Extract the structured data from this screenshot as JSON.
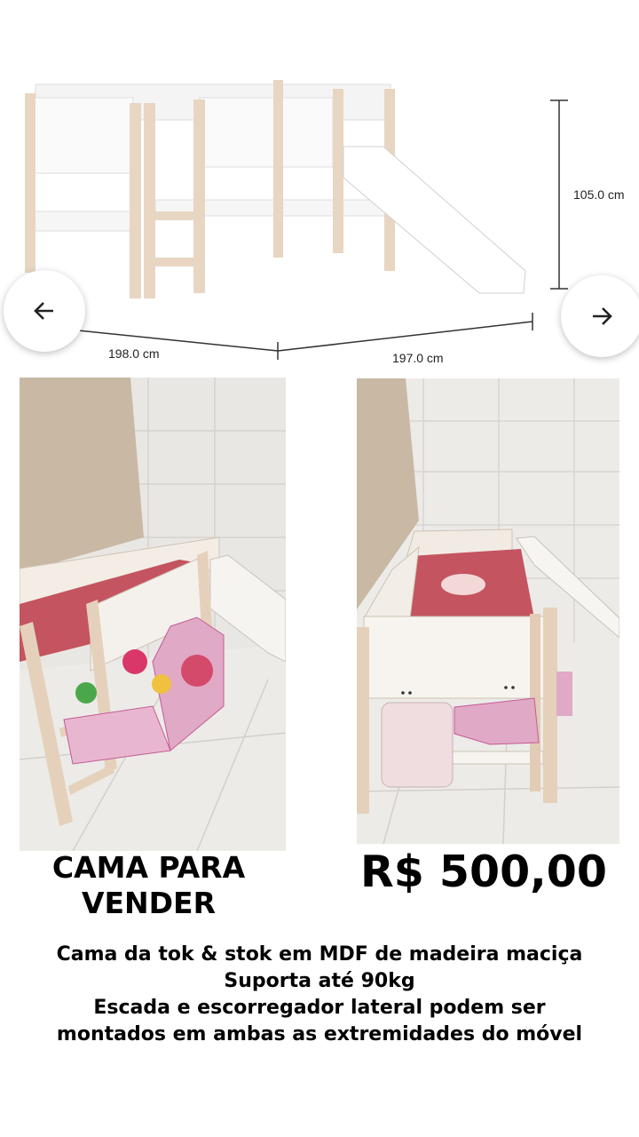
{
  "product_diagram": {
    "height_label": "105.0 cm",
    "width_left_label": "198.0 cm",
    "width_right_label": "197.0 cm"
  },
  "nav": {
    "prev_icon": "arrow-left-icon",
    "next_icon": "arrow-right-icon"
  },
  "headline": {
    "line1": "CAMA PARA",
    "line2": "VENDER"
  },
  "price": "R$ 500,00",
  "description": {
    "line1": "Cama da tok & stok em MDF de madeira maciça",
    "line2": "Suporta até 90kg",
    "line3": "Escada e escorregador lateral podem ser",
    "line4": "montados em ambas as extremidades do móvel"
  },
  "colors": {
    "wood": "#e8d6c2",
    "panel": "#ffffff",
    "mattress": "#c4545f",
    "wall": "#c8b8a4"
  }
}
